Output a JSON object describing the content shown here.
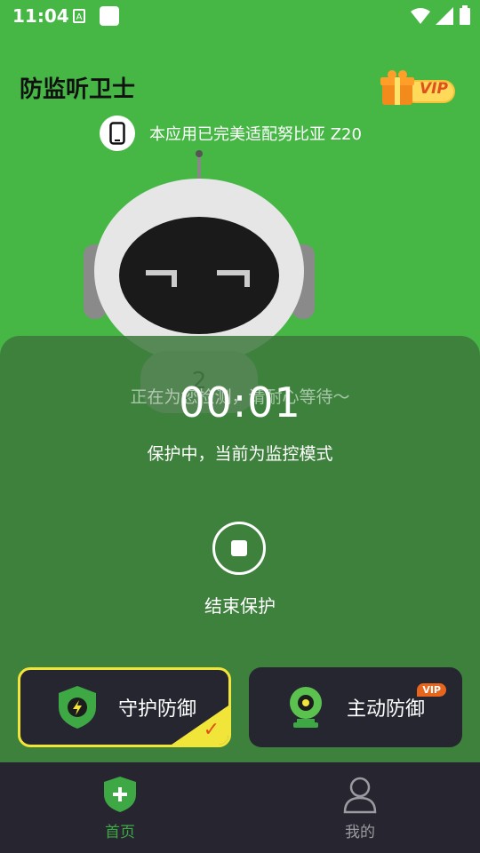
{
  "status_bar": {
    "time": "11:04"
  },
  "header": {
    "title": "防监听卫士",
    "vip_label": "VIP",
    "device_text": "本应用已完美适配努比亚 Z20"
  },
  "robot": {
    "chest_number": "2"
  },
  "scan": {
    "progress_text": "正在为您检测，请耐心等待～",
    "timer": "00:01",
    "mode_text": "保护中，当前为监控模式",
    "stop_label": "结束保护"
  },
  "cards": {
    "guard_label": "守护防御",
    "active_label": "主动防御",
    "active_badge": "VIP",
    "guard_check": "✓"
  },
  "nav": {
    "home_label": "首页",
    "mine_label": "我的"
  },
  "colors": {
    "brand_green": "#46b745",
    "card_bg": "#262630",
    "highlight_yellow": "#f2e53a",
    "vip_orange": "#e8651e"
  }
}
